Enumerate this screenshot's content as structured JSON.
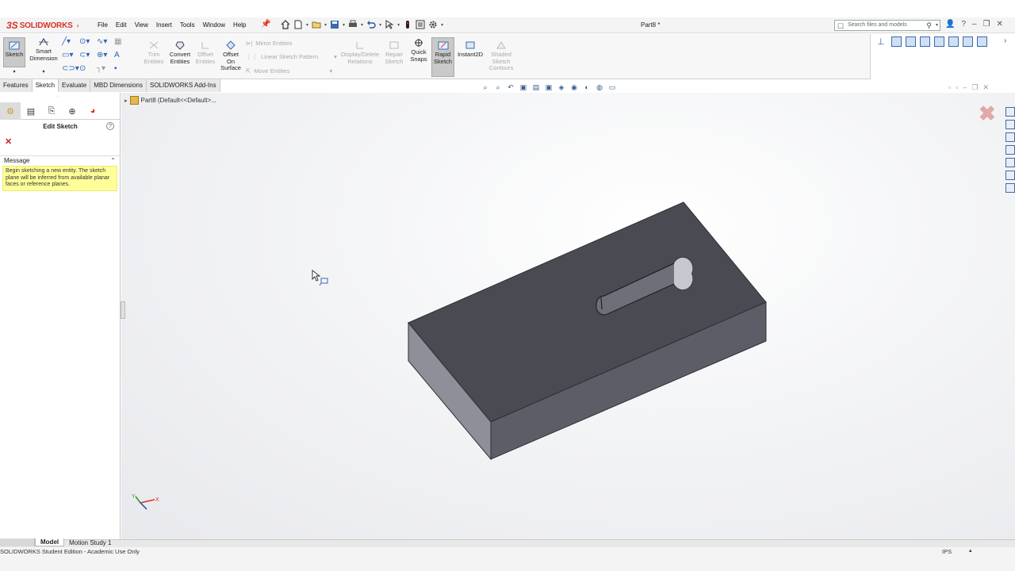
{
  "app": {
    "brand": "SOLIDWORKS",
    "doc_title": "Part8 *",
    "menu": [
      "File",
      "Edit",
      "View",
      "Insert",
      "Tools",
      "Window",
      "Help"
    ],
    "search_placeholder": "Search files and models"
  },
  "ribbon": {
    "sketch": "Sketch",
    "smart_dimension_1": "Smart",
    "smart_dimension_2": "Dimension",
    "trim_1": "Trim",
    "trim_2": "Entities",
    "convert_1": "Convert",
    "convert_2": "Entities",
    "offset_1": "Offset",
    "offset_2": "Entities",
    "offset_surface_1": "Offset",
    "offset_surface_2": "On",
    "offset_surface_3": "Surface",
    "mirror": "Mirror Entities",
    "linear_pattern": "Linear Sketch Pattern",
    "move": "Move Entities",
    "display_delete_1": "Display/Delete",
    "display_delete_2": "Relations",
    "repair_1": "Repair",
    "repair_2": "Sketch",
    "quick_snaps_1": "Quick",
    "quick_snaps_2": "Snaps",
    "rapid_1": "Rapid",
    "rapid_2": "Sketch",
    "instant2d": "Instant2D",
    "shaded_1": "Shaded",
    "shaded_2": "Sketch",
    "shaded_3": "Contours"
  },
  "tabs": [
    "Features",
    "Sketch",
    "Evaluate",
    "MBD Dimensions",
    "SOLIDWORKS Add-Ins"
  ],
  "active_tab": "Sketch",
  "property_manager": {
    "title": "Edit Sketch",
    "message_header": "Message",
    "message_body": "Begin sketching a new entity. The sketch plane will be inferred from available planar faces or reference planes."
  },
  "tree": {
    "root": "Part8  (Default<<Default>..."
  },
  "bottom_tabs": [
    "Model",
    "Motion Study 1"
  ],
  "active_bottom_tab": "Model",
  "status": {
    "left": "SOLIDWORKS Student Edition - Academic Use Only",
    "units": "IPS"
  },
  "colors": {
    "brand_red": "#d8322a",
    "model_face": "#4a4b52",
    "model_side": "#8e8f99",
    "model_front": "#5c5d66",
    "message_bg": "#ffff99"
  }
}
